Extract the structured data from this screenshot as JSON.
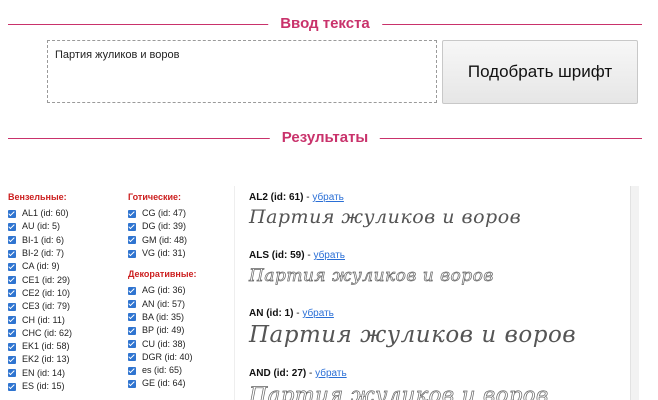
{
  "input_section": {
    "title": "Ввод текста",
    "text_value": "Партия жуликов и воров",
    "button_label": "Подобрать шрифт"
  },
  "results_section": {
    "title": "Результаты"
  },
  "groups": {
    "monogram": {
      "title": "Вензельные:",
      "items": [
        "AL1 (id: 60)",
        "AU (id: 5)",
        "BI-1 (id: 6)",
        "BI-2 (id: 7)",
        "CA (id: 9)",
        "CE1 (id: 29)",
        "CE2 (id: 10)",
        "CE3 (id: 79)",
        "CH (id: 11)",
        "CHC (id: 62)",
        "EK1 (id: 58)",
        "EK2 (id: 13)",
        "EN (id: 14)",
        "ES (id: 15)"
      ]
    },
    "gothic": {
      "title": "Готические:",
      "items": [
        "CG (id: 47)",
        "DG (id: 39)",
        "GM (id: 48)",
        "VG (id: 31)"
      ]
    },
    "decorative": {
      "title": "Декоративные:",
      "items": [
        "AG (id: 36)",
        "AN (id: 57)",
        "BA (id: 35)",
        "BP (id: 49)",
        "CU (id: 38)",
        "DGR (id: 40)",
        "es (id: 65)",
        "GE (id: 64)"
      ]
    }
  },
  "results": [
    {
      "name": "AL2 (id: 61)",
      "action": "убрать",
      "sample": "Партия жуликов и воров"
    },
    {
      "name": "ALS (id: 59)",
      "action": "убрать",
      "sample": "Партия жуликов и воров"
    },
    {
      "name": "AN (id: 1)",
      "action": "убрать",
      "sample": "Партия жуликов и воров"
    },
    {
      "name": "AND (id: 27)",
      "action": "убрать",
      "sample": "Партия жуликов и воров"
    }
  ],
  "result_separator": " - ",
  "colors": {
    "accent": "#c9326b",
    "group_title": "#cc1f1f",
    "link": "#2a6fd6",
    "checkbox": "#2f74d0"
  }
}
